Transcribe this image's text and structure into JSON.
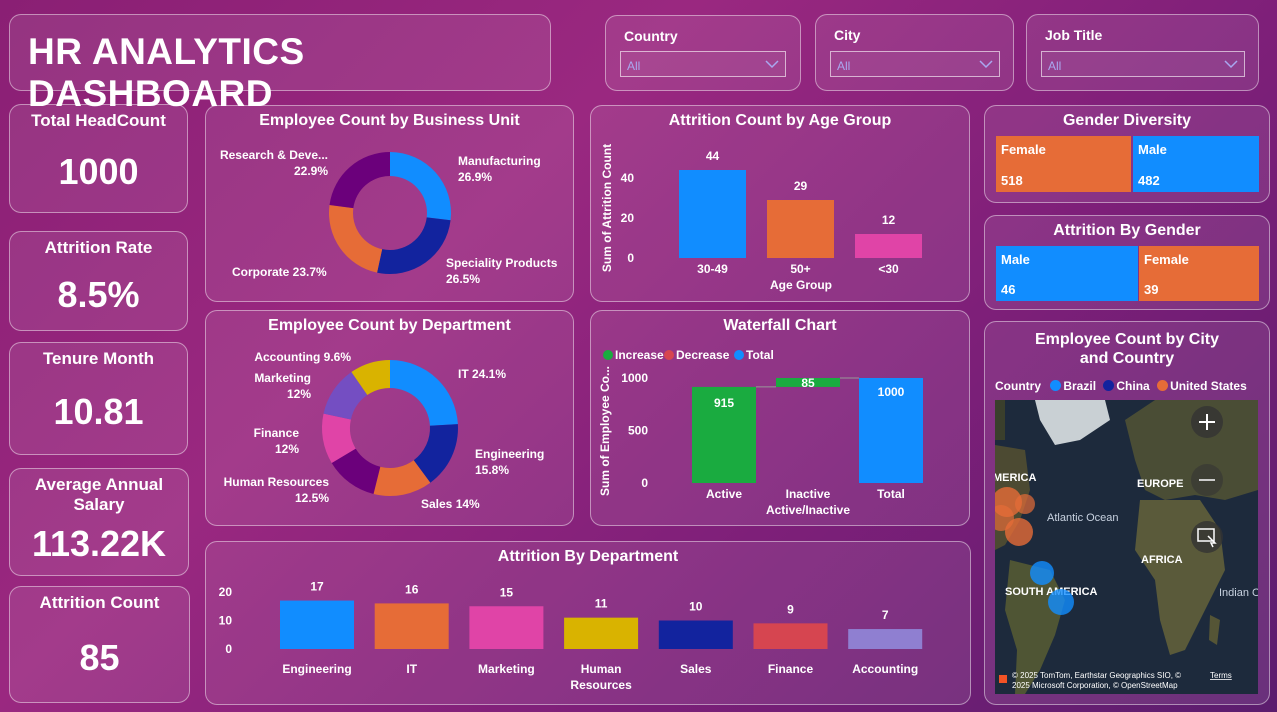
{
  "title": "HR ANALYTICS DASHBOARD",
  "slicers": [
    {
      "label": "Country",
      "value": "All"
    },
    {
      "label": "City",
      "value": "All"
    },
    {
      "label": "Job Title",
      "value": "All"
    }
  ],
  "kpis": [
    {
      "label": "Total HeadCount",
      "value": "1000"
    },
    {
      "label": "Attrition Rate",
      "value": "8.5%"
    },
    {
      "label": "Tenure Month",
      "value": "10.81"
    },
    {
      "label": "Average Annual Salary",
      "value": "113.22K"
    },
    {
      "label": "Attrition Count",
      "value": "85"
    }
  ],
  "colors": {
    "blue": "#118dff",
    "navy": "#12239e",
    "orange": "#e66c37",
    "purple": "#6b007b",
    "pink": "#e044a7",
    "violet": "#744ec2",
    "yellow": "#d9b300",
    "red": "#d64550",
    "green": "#1aab40",
    "lavender": "#8f7fd1"
  },
  "gender": {
    "title": "Gender Diversity",
    "tiles": [
      {
        "name": "Female",
        "value": "518"
      },
      {
        "name": "Male",
        "value": "482"
      }
    ]
  },
  "attr_gender": {
    "title": "Attrition By Gender",
    "tiles": [
      {
        "name": "Male",
        "value": "46"
      },
      {
        "name": "Female",
        "value": "39"
      }
    ]
  },
  "map": {
    "title": "Employee Count by City and Country",
    "legend_title": "Country",
    "legend": [
      "Brazil",
      "China",
      "United States"
    ],
    "labels": {
      "america": "MERICA",
      "europe": "EUROPE",
      "atlantic": "Atlantic Ocean",
      "africa": "AFRICA",
      "south_america": "SOUTH AMERICA",
      "indian": "Indian Ocean"
    },
    "credit1": "© 2025 TomTom, Earthstar Geographics SIO, ©",
    "credit2": "2025 Microsoft Corporation, © OpenStreetMap",
    "terms": "Terms"
  },
  "chart_data": [
    {
      "id": "bu",
      "type": "pie",
      "title": "Employee Count by Business Unit",
      "labels": [
        "Manufacturing",
        "Speciality Products",
        "Corporate",
        "Research & Deve..."
      ],
      "values": [
        26.9,
        26.5,
        23.7,
        22.9
      ],
      "value_labels": [
        "26.9%",
        "26.5%",
        "23.7%",
        "22.9%"
      ]
    },
    {
      "id": "age",
      "type": "bar",
      "title": "Attrition Count by Age Group",
      "categories": [
        "30-49",
        "50+",
        "<30"
      ],
      "values": [
        44,
        29,
        12
      ],
      "xlabel": "Age Group",
      "ylabel": "Sum of Attrition Count",
      "ylim": [
        0,
        50
      ],
      "yticks": [
        "0",
        "20",
        "40"
      ]
    },
    {
      "id": "dept",
      "type": "pie",
      "title": "Employee Count by Department",
      "labels": [
        "IT",
        "Engineering",
        "Sales",
        "Human Resources",
        "Finance",
        "Marketing",
        "Accounting"
      ],
      "values": [
        24.1,
        15.8,
        14,
        12.5,
        12,
        12,
        9.6
      ],
      "value_labels": [
        "24.1%",
        "15.8%",
        "14%",
        "12.5%",
        "12%",
        "12%",
        "9.6%"
      ]
    },
    {
      "id": "wf",
      "type": "bar",
      "title": "Waterfall Chart",
      "legend": [
        "Increase",
        "Decrease",
        "Total"
      ],
      "categories": [
        "Active",
        "Inactive",
        "Total"
      ],
      "values": [
        915,
        85,
        1000
      ],
      "xlabel": "Active/Inactive",
      "ylabel": "Sum of Employee Co...",
      "ylim": [
        0,
        1000
      ],
      "yticks": [
        "0",
        "500",
        "1000"
      ]
    },
    {
      "id": "attdept",
      "type": "bar",
      "title": "Attrition By Department",
      "categories": [
        "Engineering",
        "IT",
        "Marketing",
        "Human Resources",
        "Sales",
        "Finance",
        "Accounting"
      ],
      "values": [
        17,
        16,
        15,
        11,
        10,
        9,
        7
      ],
      "ylim": [
        0,
        20
      ],
      "yticks": [
        "0",
        "10",
        "20"
      ]
    }
  ]
}
